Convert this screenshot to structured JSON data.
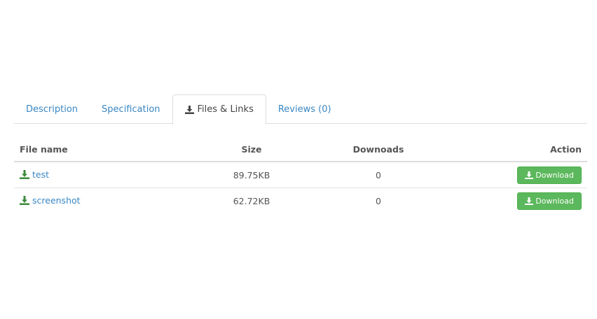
{
  "tabs": [
    {
      "label": "Description",
      "active": false
    },
    {
      "label": "Specification",
      "active": false
    },
    {
      "label": "Files & Links",
      "active": true,
      "icon": "download-icon"
    },
    {
      "label": "Reviews (0)",
      "active": false
    }
  ],
  "table": {
    "headers": {
      "name": "File name",
      "size": "Size",
      "downloads": "Downoads",
      "action": "Action"
    },
    "rows": [
      {
        "name": "test",
        "size": "89.75KB",
        "downloads": "0",
        "button": "Download"
      },
      {
        "name": "screenshot",
        "size": "62.72KB",
        "downloads": "0",
        "button": "Download"
      }
    ]
  },
  "colors": {
    "link": "#3a87c3",
    "download_icon": "#3c8a3c",
    "button": "#5cb85c"
  }
}
